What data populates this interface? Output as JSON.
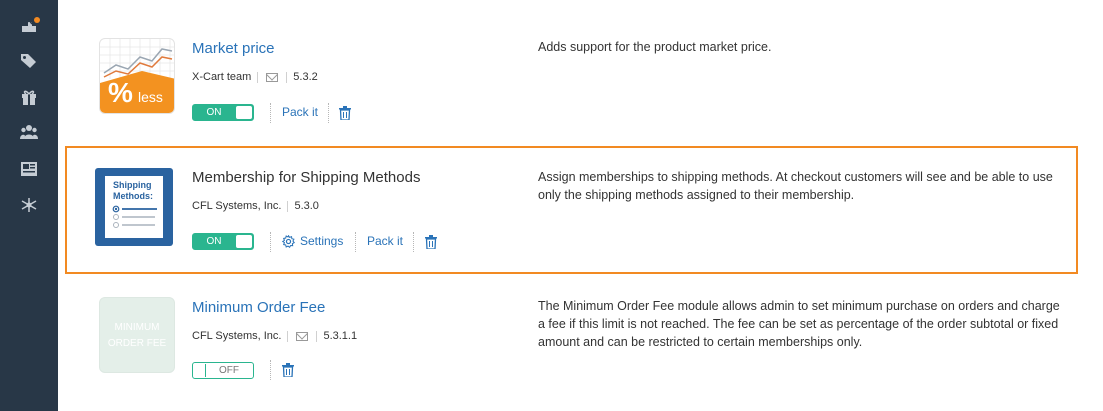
{
  "sidebar": {
    "icons": [
      {
        "name": "modules-upgrade-icon"
      },
      {
        "name": "tags-icon"
      },
      {
        "name": "gift-icon"
      },
      {
        "name": "users-icon"
      },
      {
        "name": "content-icon"
      },
      {
        "name": "network-icon"
      }
    ],
    "notification_color": "#f28a22"
  },
  "modules": [
    {
      "name": "Market price",
      "author": "X-Cart team",
      "version": "5.3.2",
      "logo_text_1": "%",
      "logo_text_2": "less",
      "description": "Adds support for the product market price.",
      "toggle": "ON",
      "pack_label": "Pack it"
    },
    {
      "name": "Membership for Shipping Methods",
      "author": "CFL Systems, Inc.",
      "version": "5.3.0",
      "logo_title_1": "Shipping",
      "logo_title_2": "Methods:",
      "description": "Assign memberships to shipping methods. At checkout customers will see and be able to use only the shipping methods assigned to their membership.",
      "toggle": "ON",
      "settings_label": "Settings",
      "pack_label": "Pack it"
    },
    {
      "name": "Minimum Order Fee",
      "author": "CFL Systems, Inc.",
      "version": "5.3.1.1",
      "logo_text_1": "MINIMUM",
      "logo_text_2": "ORDER FEE",
      "description": "The Minimum Order Fee module allows admin to set minimum purchase on orders and charge a fee if this limit is not reached. The fee can be set as percentage of the order subtotal or fixed amount and can be restricted to certain memberships only.",
      "toggle": "OFF"
    }
  ],
  "colors": {
    "accent": "#2ab58f",
    "link": "#2a73b8",
    "highlight": "#f28a22",
    "sidebar": "#283747"
  }
}
